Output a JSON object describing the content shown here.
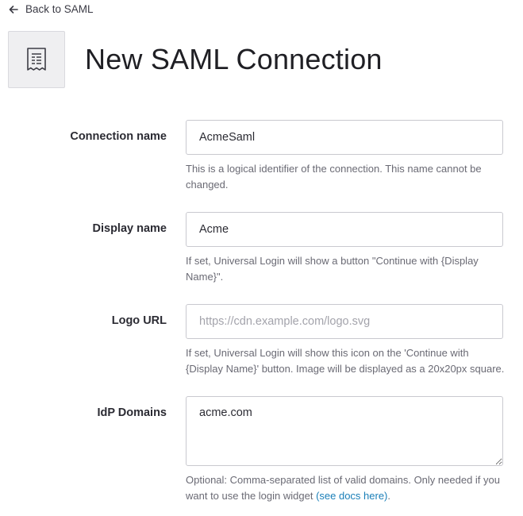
{
  "nav": {
    "back_label": "Back to SAML"
  },
  "page": {
    "title": "New SAML Connection"
  },
  "form": {
    "connection_name": {
      "label": "Connection name",
      "value": "AcmeSaml",
      "help": "This is a logical identifier of the connection. This name cannot be changed."
    },
    "display_name": {
      "label": "Display name",
      "value": "Acme",
      "help": "If set, Universal Login will show a button \"Continue with {Display Name}\"."
    },
    "logo_url": {
      "label": "Logo URL",
      "value": "",
      "placeholder": "https://cdn.example.com/logo.svg",
      "help": "If set, Universal Login will show this icon on the 'Continue with {Display Name}' button. Image will be displayed as a 20x20px square."
    },
    "idp_domains": {
      "label": "IdP Domains",
      "value": "acme.com",
      "help_prefix": "Optional: Comma-separated list of valid domains. Only needed if you want to use the login widget ",
      "help_link": "(see docs here)",
      "help_suffix": "."
    }
  }
}
